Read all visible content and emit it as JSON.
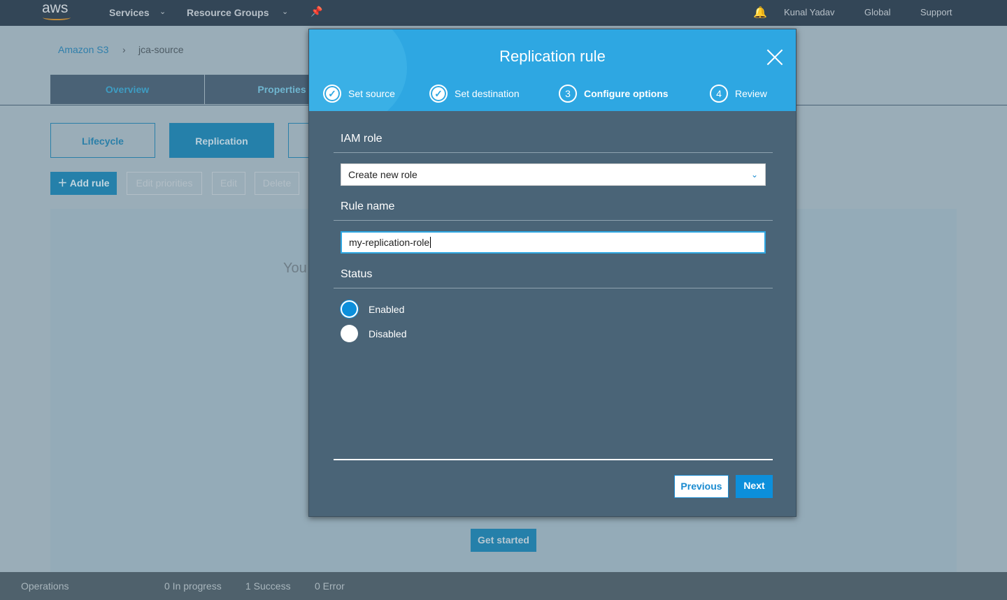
{
  "topbar": {
    "logo": "aws",
    "services": "Services",
    "resource_groups": "Resource Groups",
    "user": "Kunal Yadav",
    "region": "Global",
    "support": "Support"
  },
  "breadcrumb": {
    "root": "Amazon S3",
    "current": "jca-source"
  },
  "tabs": [
    "Overview",
    "Properties"
  ],
  "subtabs": [
    "Lifecycle",
    "Replication"
  ],
  "actions": {
    "add_rule": "Add rule",
    "edit_priorities": "Edit priorities",
    "edit": "Edit",
    "delete": "Delete"
  },
  "panel": {
    "text_partial": "You",
    "get_started": "Get started"
  },
  "footer": {
    "operations": "Operations",
    "in_progress": "0 In progress",
    "success": "1 Success",
    "error": "0 Error"
  },
  "modal": {
    "title": "Replication rule",
    "steps": [
      {
        "num": "✓",
        "label": "Set source"
      },
      {
        "num": "✓",
        "label": "Set destination"
      },
      {
        "num": "3",
        "label": "Configure options"
      },
      {
        "num": "4",
        "label": "Review"
      }
    ],
    "iam_label": "IAM role",
    "iam_value": "Create new role",
    "rule_label": "Rule name",
    "rule_value": "my-replication-role",
    "status_label": "Status",
    "status_options": [
      "Enabled",
      "Disabled"
    ],
    "status_selected": "Enabled",
    "previous": "Previous",
    "next": "Next"
  }
}
